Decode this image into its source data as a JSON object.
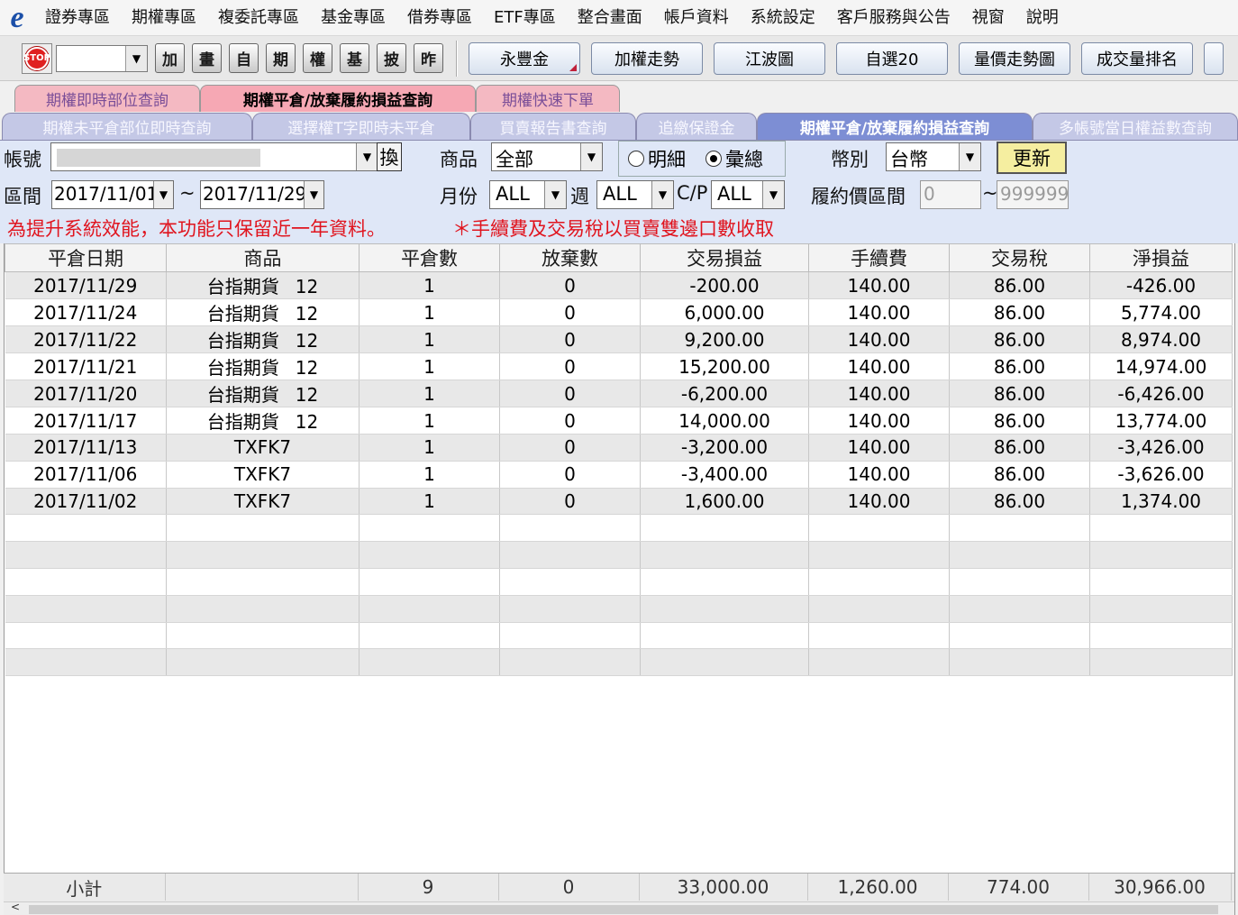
{
  "menu": {
    "logo": "e",
    "items": [
      "證券專區",
      "期權專區",
      "複委託專區",
      "基金專區",
      "借券專區",
      "ETF專區",
      "整合畫面",
      "帳戶資料",
      "系統設定",
      "客戶服務與公告",
      "視窗",
      "說明"
    ]
  },
  "toolbar": {
    "stop_label": "STOP",
    "icon_buttons": [
      "加",
      "畫",
      "自",
      "期",
      "權",
      "基",
      "披",
      "昨"
    ],
    "buttons": [
      "永豐金",
      "加權走勢",
      "江波圖",
      "自選20",
      "量價走勢圖",
      "成交量排名"
    ]
  },
  "tabs_top": [
    {
      "label": "期權即時部位查詢",
      "active": false
    },
    {
      "label": "期權平倉/放棄履約損益查詢",
      "active": true
    },
    {
      "label": "期權快速下單",
      "active": false
    }
  ],
  "tabs_sub": [
    {
      "label": "期權未平倉部位即時查詢",
      "active": false
    },
    {
      "label": "選擇權T字即時未平倉",
      "active": false
    },
    {
      "label": "買賣報告書查詢",
      "active": false
    },
    {
      "label": "追繳保證金",
      "active": false
    },
    {
      "label": "期權平倉/放棄履約損益查詢",
      "active": true
    },
    {
      "label": "多帳號當日權益數查詢",
      "active": false
    }
  ],
  "filters": {
    "account_label": "帳號",
    "switch_label": "換",
    "product_label": "商品",
    "product_value": "全部",
    "radio_detail": "明細",
    "radio_summary": "彙總",
    "summary_selected": true,
    "currency_label": "幣別",
    "currency_value": "台幣",
    "update_label": "更新",
    "range_label": "區間",
    "date_from": "2017/11/01",
    "tilde": "~",
    "date_to": "2017/11/29",
    "month_label": "月份",
    "month_value": "ALL",
    "week_label": "週",
    "week_value": "ALL",
    "cp_label": "C/P",
    "cp_value": "ALL",
    "strike_label": "履約價區間",
    "strike_from": "0",
    "strike_to": "999999",
    "warning1": "為提升系統效能，本功能只保留近一年資料。",
    "warning2": "＊手續費及交易稅以買賣雙邊口數收取"
  },
  "table": {
    "headers": [
      "平倉日期",
      "商品",
      "平倉數",
      "放棄數",
      "交易損益",
      "手續費",
      "交易稅",
      "淨損益"
    ],
    "rows": [
      [
        "2017/11/29",
        "台指期貨",
        "12",
        "1",
        "0",
        "-200.00",
        "140.00",
        "86.00",
        "-426.00"
      ],
      [
        "2017/11/24",
        "台指期貨",
        "12",
        "1",
        "0",
        "6,000.00",
        "140.00",
        "86.00",
        "5,774.00"
      ],
      [
        "2017/11/22",
        "台指期貨",
        "12",
        "1",
        "0",
        "9,200.00",
        "140.00",
        "86.00",
        "8,974.00"
      ],
      [
        "2017/11/21",
        "台指期貨",
        "12",
        "1",
        "0",
        "15,200.00",
        "140.00",
        "86.00",
        "14,974.00"
      ],
      [
        "2017/11/20",
        "台指期貨",
        "12",
        "1",
        "0",
        "-6,200.00",
        "140.00",
        "86.00",
        "-6,426.00"
      ],
      [
        "2017/11/17",
        "台指期貨",
        "12",
        "1",
        "0",
        "14,000.00",
        "140.00",
        "86.00",
        "13,774.00"
      ],
      [
        "2017/11/13",
        "TXFK7",
        "",
        "1",
        "0",
        "-3,200.00",
        "140.00",
        "86.00",
        "-3,426.00"
      ],
      [
        "2017/11/06",
        "TXFK7",
        "",
        "1",
        "0",
        "-3,400.00",
        "140.00",
        "86.00",
        "-3,626.00"
      ],
      [
        "2017/11/02",
        "TXFK7",
        "",
        "1",
        "0",
        "1,600.00",
        "140.00",
        "86.00",
        "1,374.00"
      ]
    ],
    "empty_rows": 6
  },
  "subtotal": {
    "label": "小計",
    "close_count": "9",
    "abandon_count": "0",
    "trade_pl": "33,000.00",
    "fee": "1,260.00",
    "tax": "774.00",
    "net_pl": "30,966.00"
  },
  "colors": {
    "panel_bg": "#dfe7f7",
    "warning": "#e0141e",
    "active_top_tab": "#f6a8b4",
    "active_sub_tab": "#7d8ed4",
    "update_button": "#f5eea0"
  }
}
